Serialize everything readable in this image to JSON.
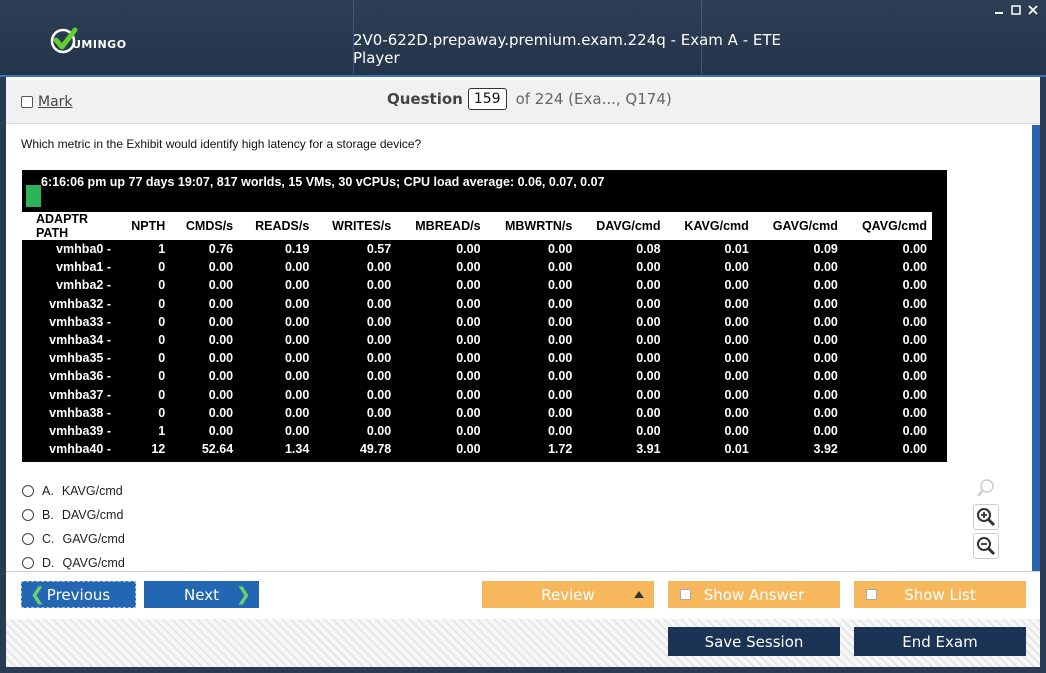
{
  "window": {
    "title": "2V0-622D.prepaway.premium.exam.224q - Exam A - ETE Player",
    "logo_text": "UMINGO"
  },
  "header": {
    "mark_label": "Mark",
    "question_label": "Question",
    "question_number": "159",
    "question_of": "of 224 (Exa..., Q174)"
  },
  "question": {
    "text": "Which metric in the Exhibit would identify high latency for a storage device?"
  },
  "exhibit": {
    "status_line": "6:16:06 pm up 77 days 19:07, 817 worlds, 15 VMs, 30 vCPUs; CPU load average: 0.06, 0.07, 0.07",
    "columns": [
      "ADAPTR PATH",
      "NPTH",
      "CMDS/s",
      "READS/s",
      "WRITES/s",
      "MBREAD/s",
      "MBWRTN/s",
      "DAVG/cmd",
      "KAVG/cmd",
      "GAVG/cmd",
      "QAVG/cmd"
    ],
    "rows": [
      [
        "vmhba0 -",
        "1",
        "0.76",
        "0.19",
        "0.57",
        "0.00",
        "0.00",
        "0.08",
        "0.01",
        "0.09",
        "0.00"
      ],
      [
        "vmhba1 -",
        "0",
        "0.00",
        "0.00",
        "0.00",
        "0.00",
        "0.00",
        "0.00",
        "0.00",
        "0.00",
        "0.00"
      ],
      [
        "vmhba2 -",
        "0",
        "0.00",
        "0.00",
        "0.00",
        "0.00",
        "0.00",
        "0.00",
        "0.00",
        "0.00",
        "0.00"
      ],
      [
        "vmhba32 -",
        "0",
        "0.00",
        "0.00",
        "0.00",
        "0.00",
        "0.00",
        "0.00",
        "0.00",
        "0.00",
        "0.00"
      ],
      [
        "vmhba33 -",
        "0",
        "0.00",
        "0.00",
        "0.00",
        "0.00",
        "0.00",
        "0.00",
        "0.00",
        "0.00",
        "0.00"
      ],
      [
        "vmhba34 -",
        "0",
        "0.00",
        "0.00",
        "0.00",
        "0.00",
        "0.00",
        "0.00",
        "0.00",
        "0.00",
        "0.00"
      ],
      [
        "vmhba35 -",
        "0",
        "0.00",
        "0.00",
        "0.00",
        "0.00",
        "0.00",
        "0.00",
        "0.00",
        "0.00",
        "0.00"
      ],
      [
        "vmhba36 -",
        "0",
        "0.00",
        "0.00",
        "0.00",
        "0.00",
        "0.00",
        "0.00",
        "0.00",
        "0.00",
        "0.00"
      ],
      [
        "vmhba37 -",
        "0",
        "0.00",
        "0.00",
        "0.00",
        "0.00",
        "0.00",
        "0.00",
        "0.00",
        "0.00",
        "0.00"
      ],
      [
        "vmhba38 -",
        "0",
        "0.00",
        "0.00",
        "0.00",
        "0.00",
        "0.00",
        "0.00",
        "0.00",
        "0.00",
        "0.00"
      ],
      [
        "vmhba39 -",
        "1",
        "0.00",
        "0.00",
        "0.00",
        "0.00",
        "0.00",
        "0.00",
        "0.00",
        "0.00",
        "0.00"
      ],
      [
        "vmhba40 -",
        "12",
        "52.64",
        "1.34",
        "49.78",
        "0.00",
        "1.72",
        "3.91",
        "0.01",
        "3.92",
        "0.00"
      ]
    ]
  },
  "options": [
    {
      "letter": "A.",
      "text": "KAVG/cmd"
    },
    {
      "letter": "B.",
      "text": "DAVG/cmd"
    },
    {
      "letter": "C.",
      "text": "GAVG/cmd"
    },
    {
      "letter": "D.",
      "text": "QAVG/cmd"
    }
  ],
  "nav": {
    "previous_label": "Previous",
    "next_label": "Next",
    "review_label": "Review",
    "show_answer_label": "Show Answer",
    "show_list_label": "Show List"
  },
  "footer": {
    "save_label": "Save Session",
    "end_label": "End Exam"
  },
  "colors": {
    "accent_blue": "#2366b2",
    "orange": "#f7b75c",
    "navy": "#1b3354"
  },
  "icons": [
    "check-logo-icon",
    "minimize-icon",
    "maximize-icon",
    "close-icon",
    "magnifier-icon",
    "zoom-in-icon",
    "zoom-out-icon",
    "chevron-left-icon",
    "chevron-right-icon",
    "triangle-up-icon"
  ]
}
